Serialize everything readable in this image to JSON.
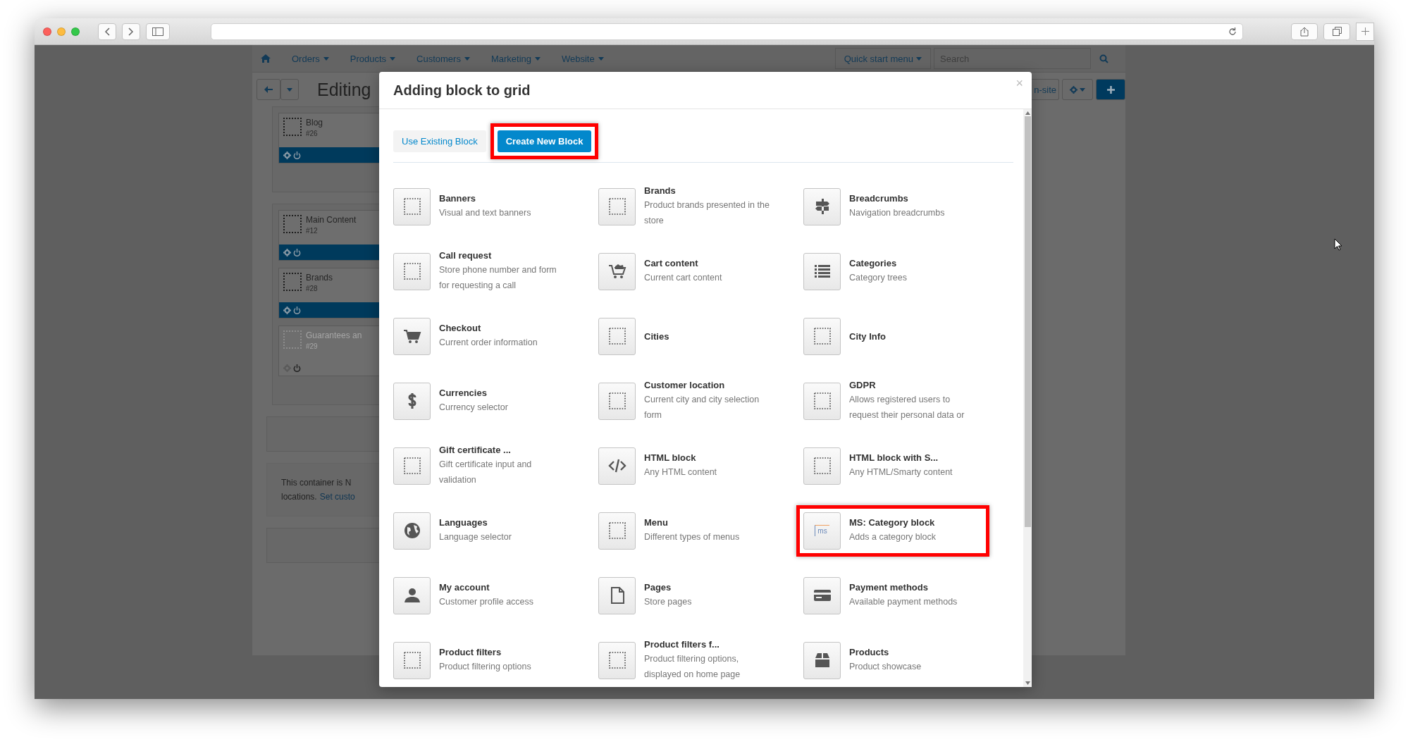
{
  "backdrop": {
    "nav": [
      {
        "label": "Orders"
      },
      {
        "label": "Products"
      },
      {
        "label": "Customers"
      },
      {
        "label": "Marketing"
      },
      {
        "label": "Website"
      }
    ],
    "quick_start": "Quick start menu",
    "search": {
      "placeholder": "Search"
    },
    "page_title": "Editing",
    "preview_button": "n-site",
    "containers": [
      {
        "blocks": [
          {
            "name": "Blog",
            "id": "#26",
            "disabled": false
          }
        ]
      },
      {
        "blocks": [
          {
            "name": "Main Content",
            "id": "#12",
            "disabled": false
          },
          {
            "name": "Brands",
            "id": "#28",
            "disabled": false
          },
          {
            "name": "Guarantees an",
            "id": "#29",
            "disabled": true
          }
        ]
      }
    ],
    "notice": {
      "text": "This container is N",
      "line2": "locations.",
      "link": "Set custo"
    }
  },
  "modal": {
    "title": "Adding block to grid",
    "close": "×",
    "tabs": [
      {
        "label": "Use Existing Block",
        "selected": false,
        "highlighted": false
      },
      {
        "label": "Create New Block",
        "selected": true,
        "highlighted": true
      }
    ],
    "blocks": [
      {
        "kind": "placeholder",
        "title": "Banners",
        "description": "Visual and text banners",
        "highlighted": false
      },
      {
        "kind": "placeholder",
        "title": "Brands",
        "description": "Product brands presented in the store",
        "highlighted": false
      },
      {
        "kind": "signpost",
        "title": "Breadcrumbs",
        "description": "Navigation breadcrumbs",
        "highlighted": false
      },
      {
        "kind": "placeholder",
        "title": "Call request",
        "description": "Store phone number and form for requesting a call",
        "highlighted": false
      },
      {
        "kind": "cart-full",
        "title": "Cart content",
        "description": "Current cart content",
        "highlighted": false
      },
      {
        "kind": "list",
        "title": "Categories",
        "description": "Category trees",
        "highlighted": false
      },
      {
        "kind": "cart",
        "title": "Checkout",
        "description": "Current order information",
        "highlighted": false
      },
      {
        "kind": "placeholder",
        "title": "Cities",
        "highlighted": false
      },
      {
        "kind": "placeholder",
        "title": "City Info",
        "highlighted": false
      },
      {
        "kind": "dollar",
        "title": "Currencies",
        "description": "Currency selector",
        "highlighted": false
      },
      {
        "kind": "placeholder",
        "title": "Customer location",
        "description": "Current city and city selection form",
        "highlighted": false
      },
      {
        "kind": "placeholder",
        "title": "GDPR",
        "description": "Allows registered users to request their personal data or",
        "highlighted": false
      },
      {
        "kind": "placeholder",
        "title": "Gift certificate ...",
        "description": "Gift certificate input and validation",
        "highlighted": false
      },
      {
        "kind": "code",
        "title": "HTML block",
        "description": "Any HTML content",
        "highlighted": false
      },
      {
        "kind": "placeholder",
        "title": "HTML block with S...",
        "description": "Any HTML/Smarty content",
        "highlighted": false
      },
      {
        "kind": "globe",
        "title": "Languages",
        "description": "Language selector",
        "highlighted": false
      },
      {
        "kind": "placeholder",
        "title": "Menu",
        "description": "Different types of menus",
        "highlighted": false
      },
      {
        "kind": "logo",
        "icon_label": "ms",
        "title": "MS: Category block",
        "description": "Adds a category block",
        "highlighted": true
      },
      {
        "kind": "person",
        "title": "My account",
        "description": "Customer profile access",
        "highlighted": false
      },
      {
        "kind": "page",
        "title": "Pages",
        "description": "Store pages",
        "highlighted": false
      },
      {
        "kind": "card",
        "title": "Payment methods",
        "description": "Available payment methods",
        "highlighted": false
      },
      {
        "kind": "placeholder",
        "title": "Product filters",
        "description": "Product filtering options",
        "highlighted": false
      },
      {
        "kind": "placeholder",
        "title": "Product filters f...",
        "description": "Product filtering options, displayed on home page",
        "highlighted": false
      },
      {
        "kind": "box",
        "title": "Products",
        "description": "Product showcase",
        "highlighted": false
      }
    ]
  }
}
